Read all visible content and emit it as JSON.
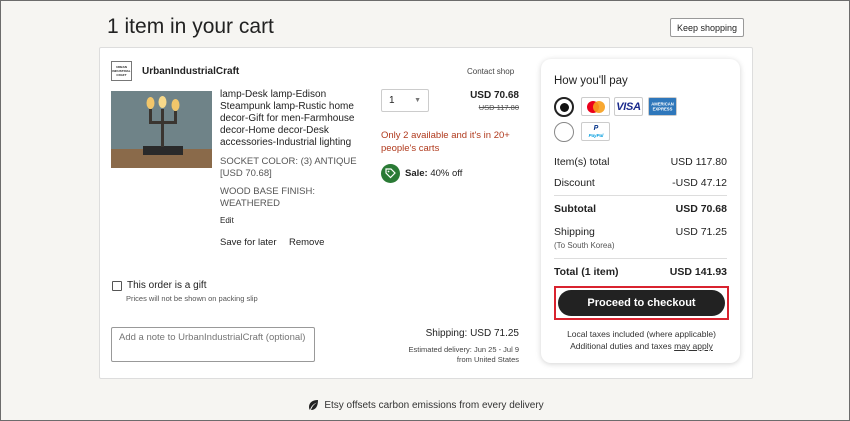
{
  "header": {
    "title": "1 item in your cart",
    "keep_shopping_label": "Keep shopping"
  },
  "shop": {
    "logo_text": [
      "URBAN",
      "INDUSTRIAL",
      "CRAFT"
    ],
    "name": "UrbanIndustrialCraft",
    "contact_label": "Contact shop"
  },
  "item": {
    "title": "lamp-Desk lamp-Edison Steampunk lamp-Rustic home decor-Gift for men-Farmhouse decor-Home decor-Desk accessories-Industrial lighting",
    "variant_socket": "SOCKET COLOR: (3) ANTIQUE [USD 70.68]",
    "variant_base": "WOOD BASE FINISH: WEATHERED",
    "edit_label": "Edit",
    "save_later_label": "Save for later",
    "remove_label": "Remove",
    "quantity": "1",
    "price": "USD 70.68",
    "original_price": "USD 117.80",
    "stock_warning": "Only 2 available and it's in 20+ people's carts",
    "sale_label": "Sale:",
    "sale_value": "40% off"
  },
  "gift": {
    "label": "This order is a gift",
    "sublabel": "Prices will not be shown on packing slip"
  },
  "note": {
    "placeholder": "Add a note to UrbanIndustrialCraft (optional)"
  },
  "shipping": {
    "cost_text": "Shipping: USD 71.25",
    "estimated_delivery": "Estimated delivery: Jun 25 - Jul 9",
    "from_text": "from United States"
  },
  "payment": {
    "title": "How you'll pay",
    "methods": [
      "mastercard-icon",
      "visa-icon",
      "amex-icon",
      "paypal-icon"
    ],
    "visa_text": "VISA",
    "amex_text": "AMERICAN EXPRESS",
    "paypal_text": "PayPal"
  },
  "summary": {
    "items_total_label": "Item(s) total",
    "items_total_value": "USD 117.80",
    "discount_label": "Discount",
    "discount_value": "-USD 47.12",
    "subtotal_label": "Subtotal",
    "subtotal_value": "USD 70.68",
    "shipping_label": "Shipping",
    "shipping_value": "USD 71.25",
    "shipping_destination": "(To South Korea)",
    "total_label": "Total (1 item)",
    "total_value": "USD 141.93",
    "checkout_label": "Proceed to checkout",
    "tax_line1": "Local taxes included (where applicable)",
    "tax_line2_prefix": "Additional duties and taxes",
    "tax_link": "may apply"
  },
  "footer": {
    "carbon_note": "Etsy offsets carbon emissions from every delivery"
  },
  "colors": {
    "stock_warning": "#b03a1d",
    "sale_badge": "#2a7a35",
    "checkout_button": "#222222",
    "highlight_border": "#d9232f"
  }
}
